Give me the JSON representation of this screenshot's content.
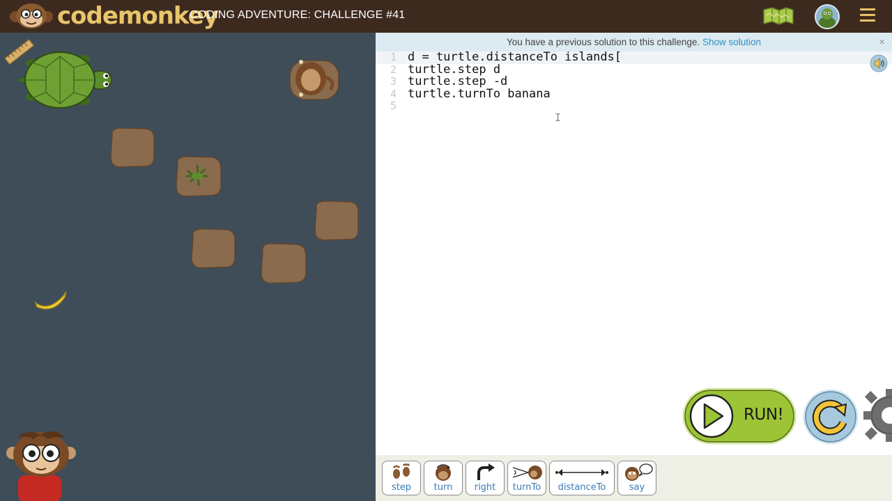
{
  "header": {
    "logo_text": "codemonkey",
    "title": "CODING ADVENTURE: CHALLENGE #41"
  },
  "notice": {
    "text": "You have a previous solution to this challenge.",
    "link": "Show solution",
    "close": "×"
  },
  "code": {
    "lines": [
      {
        "num": "1",
        "text": "d = turtle.distanceTo islands["
      },
      {
        "num": "2",
        "text": "turtle.step d"
      },
      {
        "num": "3",
        "text": "turtle.step -d"
      },
      {
        "num": "4",
        "text": "turtle.turnTo banana"
      },
      {
        "num": "5",
        "text": ""
      }
    ]
  },
  "buttons": {
    "run": "RUN!"
  },
  "toolbar": {
    "items": [
      {
        "label": "step",
        "icon": "footprints-icon"
      },
      {
        "label": "turn",
        "icon": "monkey-turn-icon"
      },
      {
        "label": "right",
        "icon": "right-arrow-icon"
      },
      {
        "label": "turnTo",
        "icon": "turnto-icon"
      },
      {
        "label": "distanceTo",
        "icon": "distance-arrow-icon"
      },
      {
        "label": "say",
        "icon": "speech-bubble-icon"
      }
    ]
  },
  "colors": {
    "header_bg": "#3d2a1f",
    "logo_yellow": "#e9c46a",
    "water": "#3f4d58",
    "island": "#8b6b4d",
    "run_green": "#a9cf3a",
    "reset_blue": "#a6c9dd",
    "link_blue": "#2d8fc4",
    "tool_label": "#3a7bb5"
  }
}
